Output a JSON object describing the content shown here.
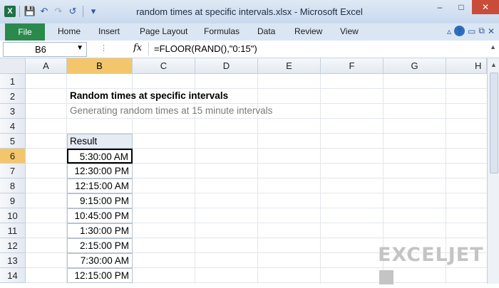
{
  "window": {
    "title": "random times at specific intervals.xlsx - Microsoft Excel",
    "app_icon": "X",
    "controls": [
      "–",
      "□",
      "✕"
    ]
  },
  "qat": {
    "save_icon": "💾",
    "undo_icon": "↶",
    "redo_icon": "↷",
    "refresh_icon": "↺",
    "more_icon": "▾"
  },
  "ribbon": {
    "file_tab": "File",
    "tabs": [
      "Home",
      "Insert",
      "Page Layout",
      "Formulas",
      "Data",
      "Review",
      "View"
    ],
    "right_controls": [
      "▵",
      "?",
      "▭",
      "⧉",
      "✕"
    ]
  },
  "formula_bar": {
    "name_box": "B6",
    "fx": "fx",
    "formula": "=FLOOR(RAND(),\"0:15\")"
  },
  "sheet": {
    "columns": [
      "A",
      "B",
      "C",
      "D",
      "E",
      "F",
      "G",
      "H"
    ],
    "selected_column": "B",
    "rows": [
      "1",
      "2",
      "3",
      "4",
      "5",
      "6",
      "7",
      "8",
      "9",
      "10",
      "11",
      "12",
      "13",
      "14"
    ],
    "selected_row": "6",
    "title": "Random times at specific intervals",
    "subtitle": "Generating random times at 15 minute intervals",
    "table_header": "Result",
    "results": [
      "5:30:00 AM",
      "12:30:00 PM",
      "12:15:00 AM",
      "9:15:00 PM",
      "10:45:00 PM",
      "1:30:00 PM",
      "2:15:00 PM",
      "7:30:00 AM",
      "12:15:00 PM"
    ]
  },
  "watermark": "EXCELJET",
  "colors": {
    "file_tab": "#2a8a4c",
    "selected_header": "#f4c66b",
    "ribbon": "#dbe6f4"
  }
}
